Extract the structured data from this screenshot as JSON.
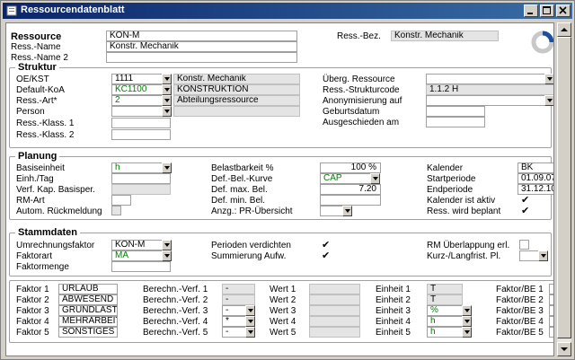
{
  "window": {
    "title": "Ressourcendatenblatt"
  },
  "header": {
    "ressource_label": "Ressource",
    "ressource_value": "KON-M",
    "name_label": "Ress.-Name",
    "name_value": "Konstr. Mechanik",
    "name2_label": "Ress.-Name 2",
    "name2_value": "",
    "bez_label": "Ress.-Bez.",
    "bez_value": "Konstr. Mechanik"
  },
  "struktur": {
    "title": "Struktur",
    "oe_label": "OE/KST",
    "oe_value": "1111",
    "oe_desc": "Konstr. Mechanik",
    "koa_label": "Default-KoA",
    "koa_value": "KC1100",
    "koa_desc": "KONSTRUKTION",
    "art_label": "Ress.-Art*",
    "art_value": "2",
    "art_desc": "Abteilungsressource",
    "person_label": "Person",
    "person_value": "",
    "klass1_label": "Ress.-Klass. 1",
    "klass1_value": "",
    "klass2_label": "Ress.-Klass. 2",
    "klass2_value": "",
    "ueberg_label": "Überg. Ressource",
    "ueberg_value": "",
    "strukturcode_label": "Ress.-Strukturcode",
    "strukturcode_value": "1.1.2 H",
    "anonym_label": "Anonymisierung auf",
    "anonym_value": "",
    "geburt_label": "Geburtsdatum",
    "geburt_value": "",
    "ausgeschieden_label": "Ausgeschieden am",
    "ausgeschieden_value": ""
  },
  "planung": {
    "title": "Planung",
    "basis_label": "Basiseinheit",
    "basis_value": "h",
    "einh_label": "Einh./Tag",
    "einh_value": "",
    "verf_label": "Verf. Kap. Basisper.",
    "verf_value": "",
    "rmart_label": "RM-Art",
    "rmart_value": "",
    "autom_label": "Autom. Rückmeldung",
    "belast_label": "Belastbarkeit %",
    "belast_value": "100 %",
    "kurve_label": "Def.-Bel.-Kurve",
    "kurve_value": "CAP",
    "maxbel_label": "Def. max. Bel.",
    "maxbel_value": "7.20",
    "minbel_label": "Def. min. Bel.",
    "minbel_value": "",
    "anzg_label": "Anzg.: PR-Übersicht",
    "anzg_value": "",
    "kalender_label": "Kalender",
    "kalender_value": "BK",
    "start_label": "Startperiode",
    "start_value": "01.09.07",
    "end_label": "Endperiode",
    "end_value": "31.12.10",
    "kalaktiv_label": "Kalender ist aktiv",
    "kalaktiv_checked": "✔",
    "beplant_label": "Ress. wird beplant",
    "beplant_checked": "✔"
  },
  "stammdaten": {
    "title": "Stammdaten",
    "umr_label": "Umrechnungsfaktor",
    "umr_value": "KON-M",
    "fart_label": "Faktorart",
    "fart_value": "MA",
    "fmenge_label": "Faktormenge",
    "fmenge_value": "",
    "perioden_label": "Perioden verdichten",
    "perioden_checked": "✔",
    "summ_label": "Summierung Aufw.",
    "summ_checked": "✔",
    "rm_label": "RM Überlappung erl.",
    "kurz_label": "Kurz-/Langfrist. Pl.",
    "kurz_value": ""
  },
  "faktoren": [
    {
      "label": "Faktor 1",
      "value": "URLAUB",
      "bv_label": "Berechn.-Verf. 1",
      "bv_value": "-",
      "bv_dd": false,
      "wert_label": "Wert 1",
      "einheit_label": "Einheit 1",
      "einheit_value": "T",
      "einheit_dd": false,
      "fbe_label": "Faktor/BE 1"
    },
    {
      "label": "Faktor 2",
      "value": "ABWESEND",
      "bv_label": "Berechn.-Verf. 2",
      "bv_value": "-",
      "bv_dd": false,
      "wert_label": "Wert 2",
      "einheit_label": "Einheit 2",
      "einheit_value": "T",
      "einheit_dd": false,
      "fbe_label": "Faktor/BE 2"
    },
    {
      "label": "Faktor 3",
      "value": "GRUNDLAST",
      "bv_label": "Berechn.-Verf. 3",
      "bv_value": "-",
      "bv_dd": true,
      "wert_label": "Wert 3",
      "einheit_label": "Einheit 3",
      "einheit_value": "%",
      "einheit_dd": true,
      "fbe_label": "Faktor/BE 3"
    },
    {
      "label": "Faktor 4",
      "value": "MEHRARBEIT",
      "bv_label": "Berechn.-Verf. 4",
      "bv_value": "*",
      "bv_dd": true,
      "wert_label": "Wert 4",
      "einheit_label": "Einheit 4",
      "einheit_value": "h",
      "einheit_dd": true,
      "fbe_label": "Faktor/BE 4"
    },
    {
      "label": "Faktor 5",
      "value": "SONSTIGES",
      "bv_label": "Berechn.-Verf. 5",
      "bv_value": "-",
      "bv_dd": true,
      "wert_label": "Wert 5",
      "einheit_label": "Einheit 5",
      "einheit_value": "h",
      "einheit_dd": true,
      "fbe_label": "Faktor/BE 5"
    }
  ],
  "colors": {
    "title_bar": "#0a246a",
    "green_text": "#008000",
    "form_bg": "#ffffff",
    "chrome": "#d4d0c8"
  },
  "icons": {
    "app": "form-icon",
    "minimize": "minimize-icon",
    "maximize": "maximize-icon",
    "close": "close-icon",
    "status": "progress-ring-icon"
  }
}
